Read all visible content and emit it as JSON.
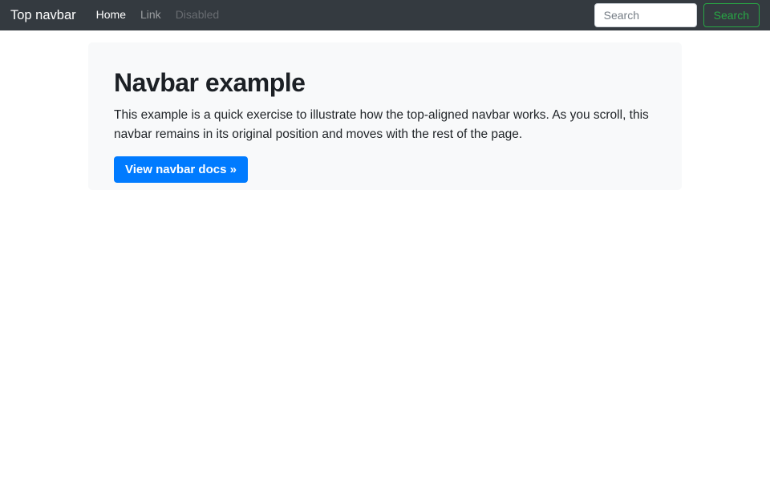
{
  "navbar": {
    "brand": "Top navbar",
    "items": [
      {
        "label": "Home",
        "state": "active"
      },
      {
        "label": "Link",
        "state": "normal"
      },
      {
        "label": "Disabled",
        "state": "disabled"
      }
    ],
    "search": {
      "placeholder": "Search",
      "button_label": "Search"
    }
  },
  "jumbotron": {
    "title": "Navbar example",
    "description": "This example is a quick exercise to illustrate how the top-aligned navbar works. As you scroll, this navbar remains in its original position and moves with the rest of the page.",
    "cta_label": "View navbar docs »"
  },
  "colors": {
    "navbar_bg": "#343a40",
    "jumbotron_bg": "#f8f9fa",
    "primary": "#007bff",
    "success": "#28a745"
  }
}
